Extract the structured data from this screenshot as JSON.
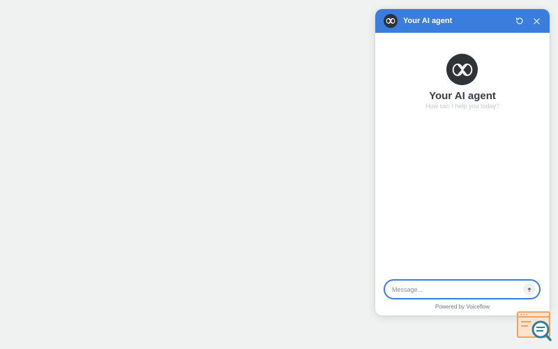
{
  "chat_widget": {
    "header": {
      "title": "Your AI agent",
      "avatar_icon": "agent-logo-icon",
      "refresh_icon": "refresh-icon",
      "close_icon": "close-icon",
      "background": "#3b7ddd"
    },
    "intro": {
      "title": "Your AI agent",
      "subtitle": "How can I help you today?",
      "avatar_icon": "agent-logo-icon"
    },
    "composer": {
      "value": "",
      "placeholder": "Message...",
      "send_icon": "arrow-up-icon",
      "accent": "#3b7ddd"
    },
    "footer": {
      "text": "Powered by Voiceflow"
    }
  },
  "corner_badge": {
    "icon": "search-document-icon",
    "colors": [
      "#f0a060",
      "#2a7f9e"
    ]
  }
}
